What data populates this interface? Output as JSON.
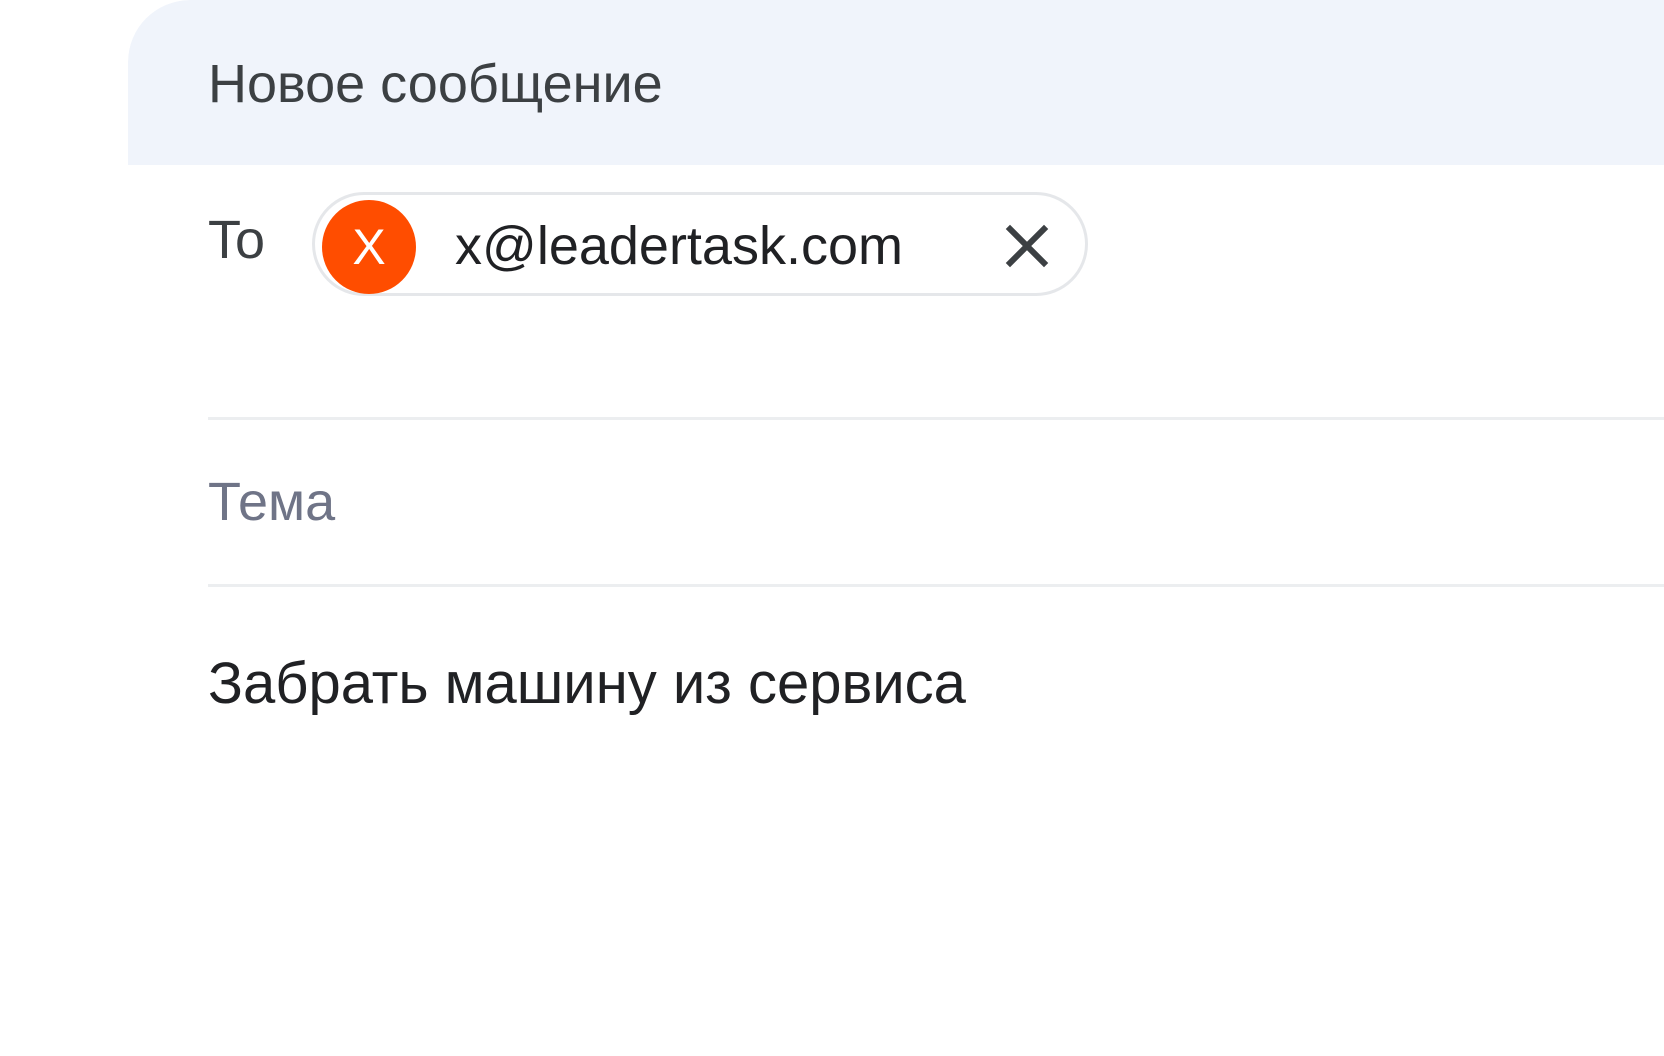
{
  "compose": {
    "title": "Новое сообщение",
    "to_label": "To",
    "recipient": {
      "avatar_initial": "X",
      "avatar_color": "#ff4d00",
      "email": "x@leadertask.com",
      "remove_icon": "close-icon"
    },
    "subject": {
      "value": "",
      "placeholder": "Тема"
    },
    "body_text": "Забрать машину из сервиса"
  },
  "colors": {
    "header_background": "#f0f4fb",
    "avatar": "#ff4d00",
    "placeholder_text": "#6f7487",
    "main_text": "#202124"
  }
}
